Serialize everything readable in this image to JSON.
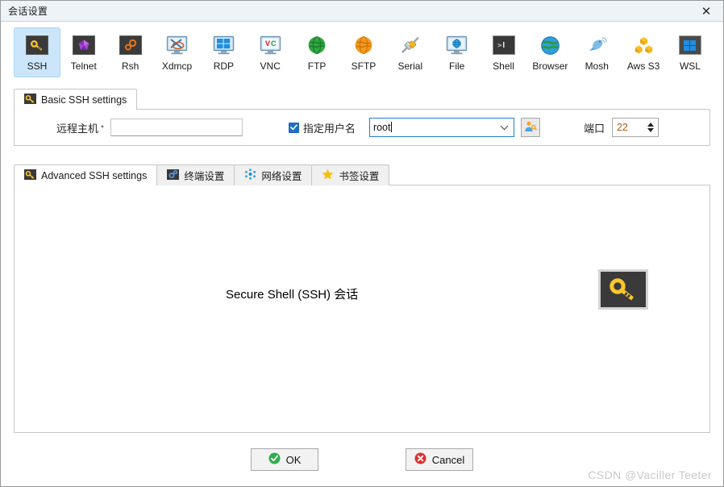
{
  "window": {
    "title": "会话设置",
    "close_label": "✕"
  },
  "protocols": [
    {
      "label": "SSH",
      "icon": "ssh-key-icon",
      "selected": true
    },
    {
      "label": "Telnet",
      "icon": "telnet-gem-icon",
      "selected": false
    },
    {
      "label": "Rsh",
      "icon": "rsh-gears-icon",
      "selected": false
    },
    {
      "label": "Xdmcp",
      "icon": "xdmcp-monitor-icon",
      "selected": false
    },
    {
      "label": "RDP",
      "icon": "rdp-windows-icon",
      "selected": false
    },
    {
      "label": "VNC",
      "icon": "vnc-monitor-icon",
      "selected": false
    },
    {
      "label": "FTP",
      "icon": "ftp-globe-icon",
      "selected": false
    },
    {
      "label": "SFTP",
      "icon": "sftp-globe-icon",
      "selected": false
    },
    {
      "label": "Serial",
      "icon": "serial-plug-icon",
      "selected": false
    },
    {
      "label": "File",
      "icon": "file-share-icon",
      "selected": false
    },
    {
      "label": "Shell",
      "icon": "shell-console-icon",
      "selected": false
    },
    {
      "label": "Browser",
      "icon": "browser-globe-icon",
      "selected": false
    },
    {
      "label": "Mosh",
      "icon": "mosh-dish-icon",
      "selected": false
    },
    {
      "label": "Aws S3",
      "icon": "aws-s3-cubes-icon",
      "selected": false
    },
    {
      "label": "WSL",
      "icon": "wsl-windows-icon",
      "selected": false
    }
  ],
  "basic": {
    "tab_label": "Basic SSH settings",
    "tab_icon": "key-icon",
    "host_label": "远程主机",
    "host_required_mark": "*",
    "host_value": "",
    "host_placeholder": "",
    "specify_username_label": "指定用户名",
    "specify_username_checked": true,
    "username_value": "root",
    "username_browse_icon": "user-key-icon",
    "port_label": "端口",
    "port_value": "22"
  },
  "lower_tabs": [
    {
      "label": "Advanced SSH settings",
      "icon": "key-icon",
      "active": true
    },
    {
      "label": "终端设置",
      "icon": "terminal-settings-icon",
      "active": false
    },
    {
      "label": "网络设置",
      "icon": "network-nodes-icon",
      "active": false
    },
    {
      "label": "书签设置",
      "icon": "star-icon",
      "active": false
    }
  ],
  "content": {
    "caption": "Secure Shell (SSH) 会话",
    "badge_icon": "ssh-key-large-icon"
  },
  "footer": {
    "ok_label": "OK",
    "ok_icon": "check-circle-icon",
    "cancel_label": "Cancel",
    "cancel_icon": "x-circle-icon"
  },
  "watermark": "CSDN @Vaciller Teeter",
  "colors": {
    "accent": "#1f6fc4",
    "selected_tab_bg": "#cbe6fb",
    "ok_green": "#2eae4e",
    "cancel_red": "#e03030",
    "key_yellow": "#fcc62a"
  }
}
